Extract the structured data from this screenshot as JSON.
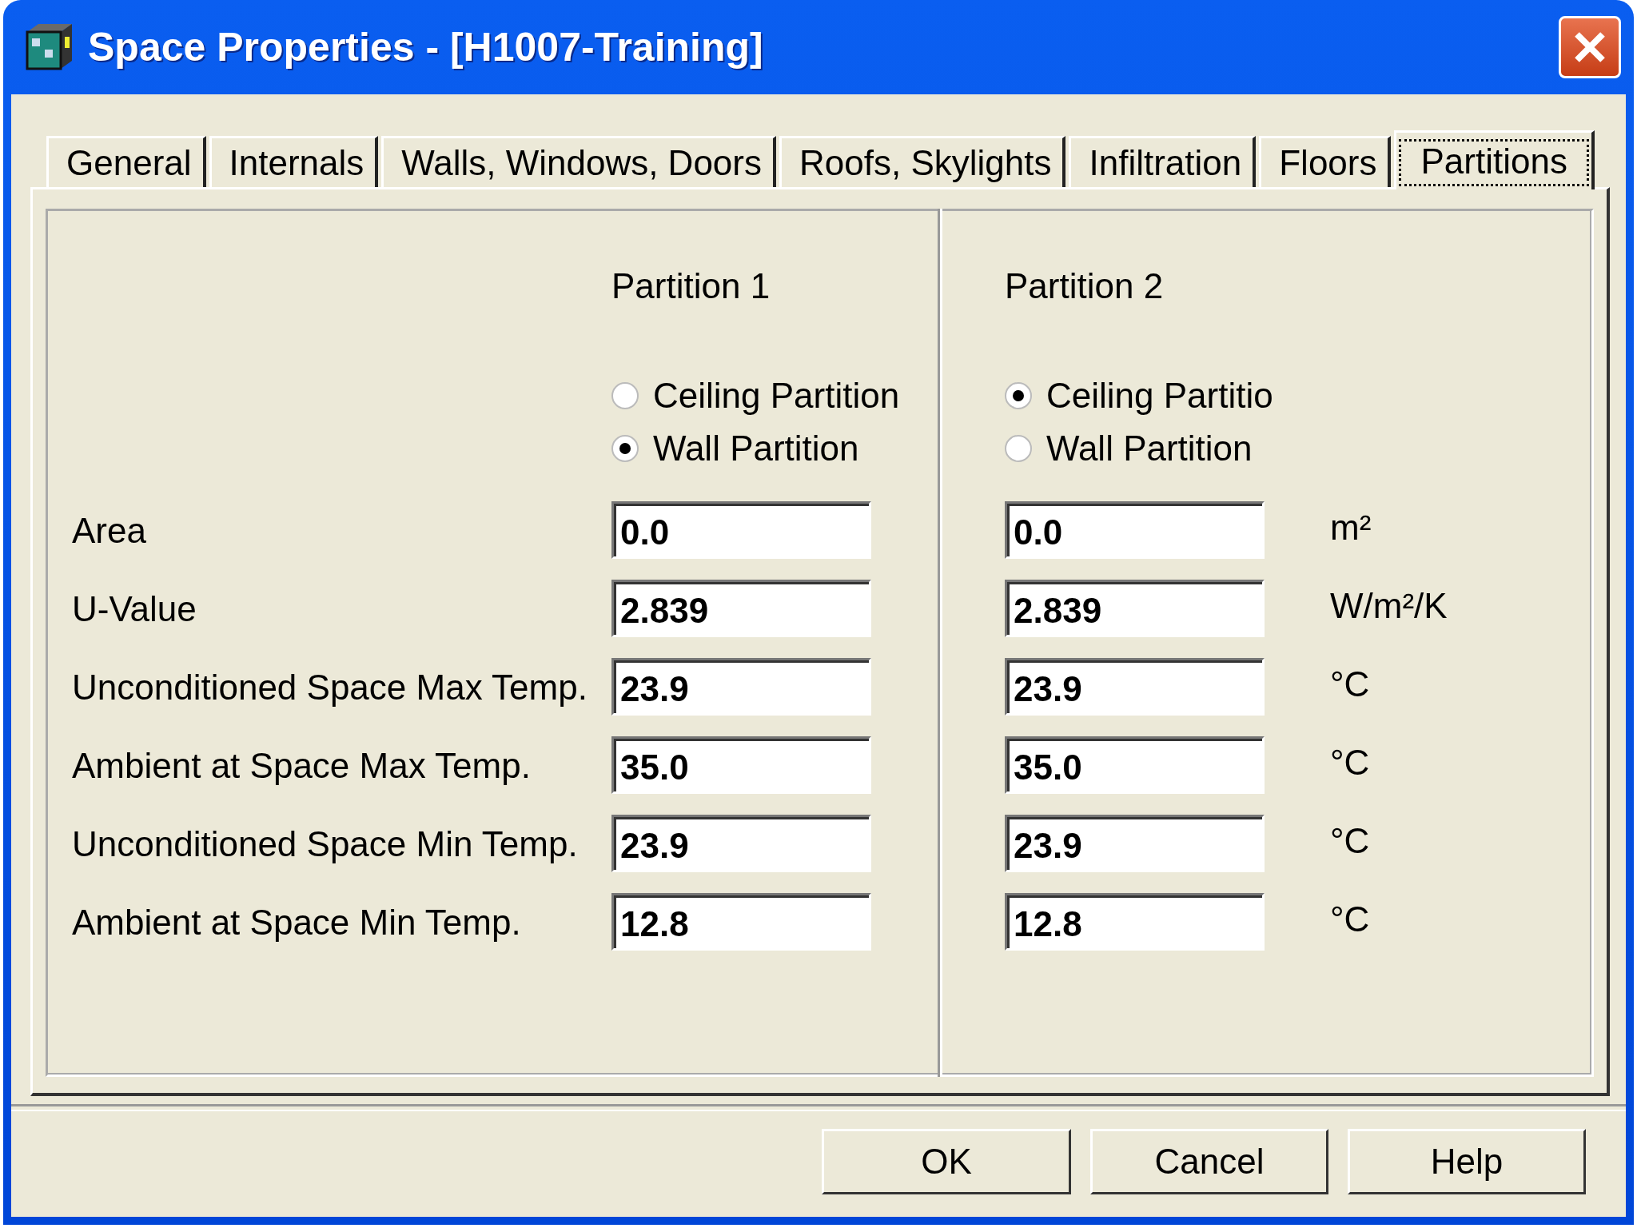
{
  "window": {
    "title": "Space Properties - [H1007-Training]"
  },
  "tabs": [
    {
      "label": "General",
      "selected": false
    },
    {
      "label": "Internals",
      "selected": false
    },
    {
      "label": "Walls, Windows, Doors",
      "selected": false
    },
    {
      "label": "Roofs, Skylights",
      "selected": false
    },
    {
      "label": "Infiltration",
      "selected": false
    },
    {
      "label": "Floors",
      "selected": false
    },
    {
      "label": "Partitions",
      "selected": true
    }
  ],
  "partitions": [
    {
      "heading": "Partition 1",
      "options": [
        {
          "label": "Ceiling Partition",
          "selected": false
        },
        {
          "label": "Wall Partition",
          "selected": true
        }
      ]
    },
    {
      "heading": "Partition 2",
      "options": [
        {
          "label": "Ceiling Partitio",
          "selected": true
        },
        {
          "label": "Wall Partition",
          "selected": false
        }
      ]
    }
  ],
  "rows": [
    {
      "label": "Area",
      "values": [
        "0.0",
        "0.0"
      ],
      "unit": "m²"
    },
    {
      "label": "U-Value",
      "values": [
        "2.839",
        "2.839"
      ],
      "unit": "W/m²/K"
    },
    {
      "label": "Unconditioned Space Max Temp.",
      "values": [
        "23.9",
        "23.9"
      ],
      "unit": "°C"
    },
    {
      "label": "Ambient at Space Max Temp.",
      "values": [
        "35.0",
        "35.0"
      ],
      "unit": "°C"
    },
    {
      "label": "Unconditioned Space Min Temp.",
      "values": [
        "23.9",
        "23.9"
      ],
      "unit": "°C"
    },
    {
      "label": "Ambient at Space Min Temp.",
      "values": [
        "12.8",
        "12.8"
      ],
      "unit": "°C"
    }
  ],
  "buttons": [
    "OK",
    "Cancel",
    "Help"
  ]
}
